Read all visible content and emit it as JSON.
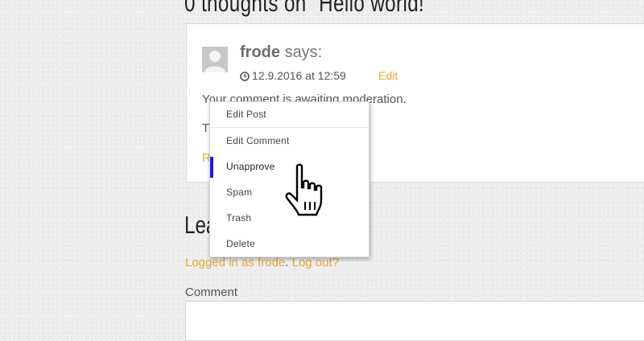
{
  "page": {
    "title": "0 thoughts on “Hello world!”"
  },
  "comment": {
    "author": "frode",
    "says": "says:",
    "date": "12.9.2016 at 12:59",
    "edit": "Edit",
    "moderation": "Your comment is awaiting moderation.",
    "text_start": "T",
    "reply_start": "R"
  },
  "leave_reply": {
    "heading": "Lea",
    "logged_in_text": "Logged in as frode",
    "logout_link": "Log out?",
    "comment_label": "Comment"
  },
  "context_menu": {
    "items": [
      {
        "label": "Edit Post"
      },
      {
        "label": "Edit Comment"
      },
      {
        "label": "Unapprove"
      },
      {
        "label": "Spam"
      },
      {
        "label": "Trash"
      },
      {
        "label": "Delete"
      }
    ]
  },
  "colors": {
    "accent": "#e8a83c",
    "active_marker": "#1a1ae0"
  },
  "icons": {
    "clock": "clock-icon",
    "avatar": "avatar-placeholder",
    "cursor": "hand-pointer-cursor"
  }
}
